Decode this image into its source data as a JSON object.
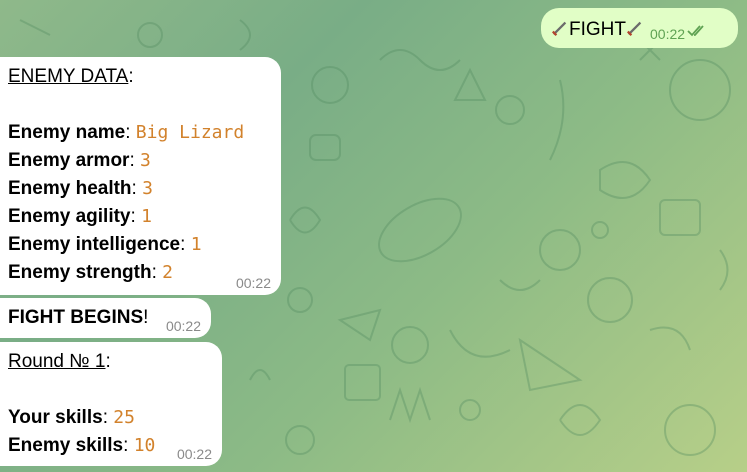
{
  "outgoing": {
    "text": "FIGHT",
    "time": "00:22"
  },
  "enemy_card": {
    "title": "ENEMY DATA",
    "rows": [
      {
        "label": "Enemy name",
        "value": "Big Lizard"
      },
      {
        "label": "Enemy armor",
        "value": "3"
      },
      {
        "label": "Enemy health",
        "value": "3"
      },
      {
        "label": "Enemy agility",
        "value": "1"
      },
      {
        "label": "Enemy intelligence",
        "value": "1"
      },
      {
        "label": "Enemy strength",
        "value": "2"
      }
    ],
    "time": "00:22"
  },
  "fight_begins": {
    "text": "FIGHT BEGINS",
    "time": "00:22"
  },
  "round": {
    "title": "Round № 1",
    "your_label": "Your skills",
    "your_value": "25",
    "enemy_label": "Enemy skills",
    "enemy_value": "10",
    "time": "00:22"
  },
  "colors": {
    "accent_value": "#d2822c",
    "outgoing_bubble": "#e1fec6",
    "read_check": "#5fa253"
  },
  "icons": [
    "sword-icon",
    "double-check-icon",
    "doodle-pattern"
  ]
}
